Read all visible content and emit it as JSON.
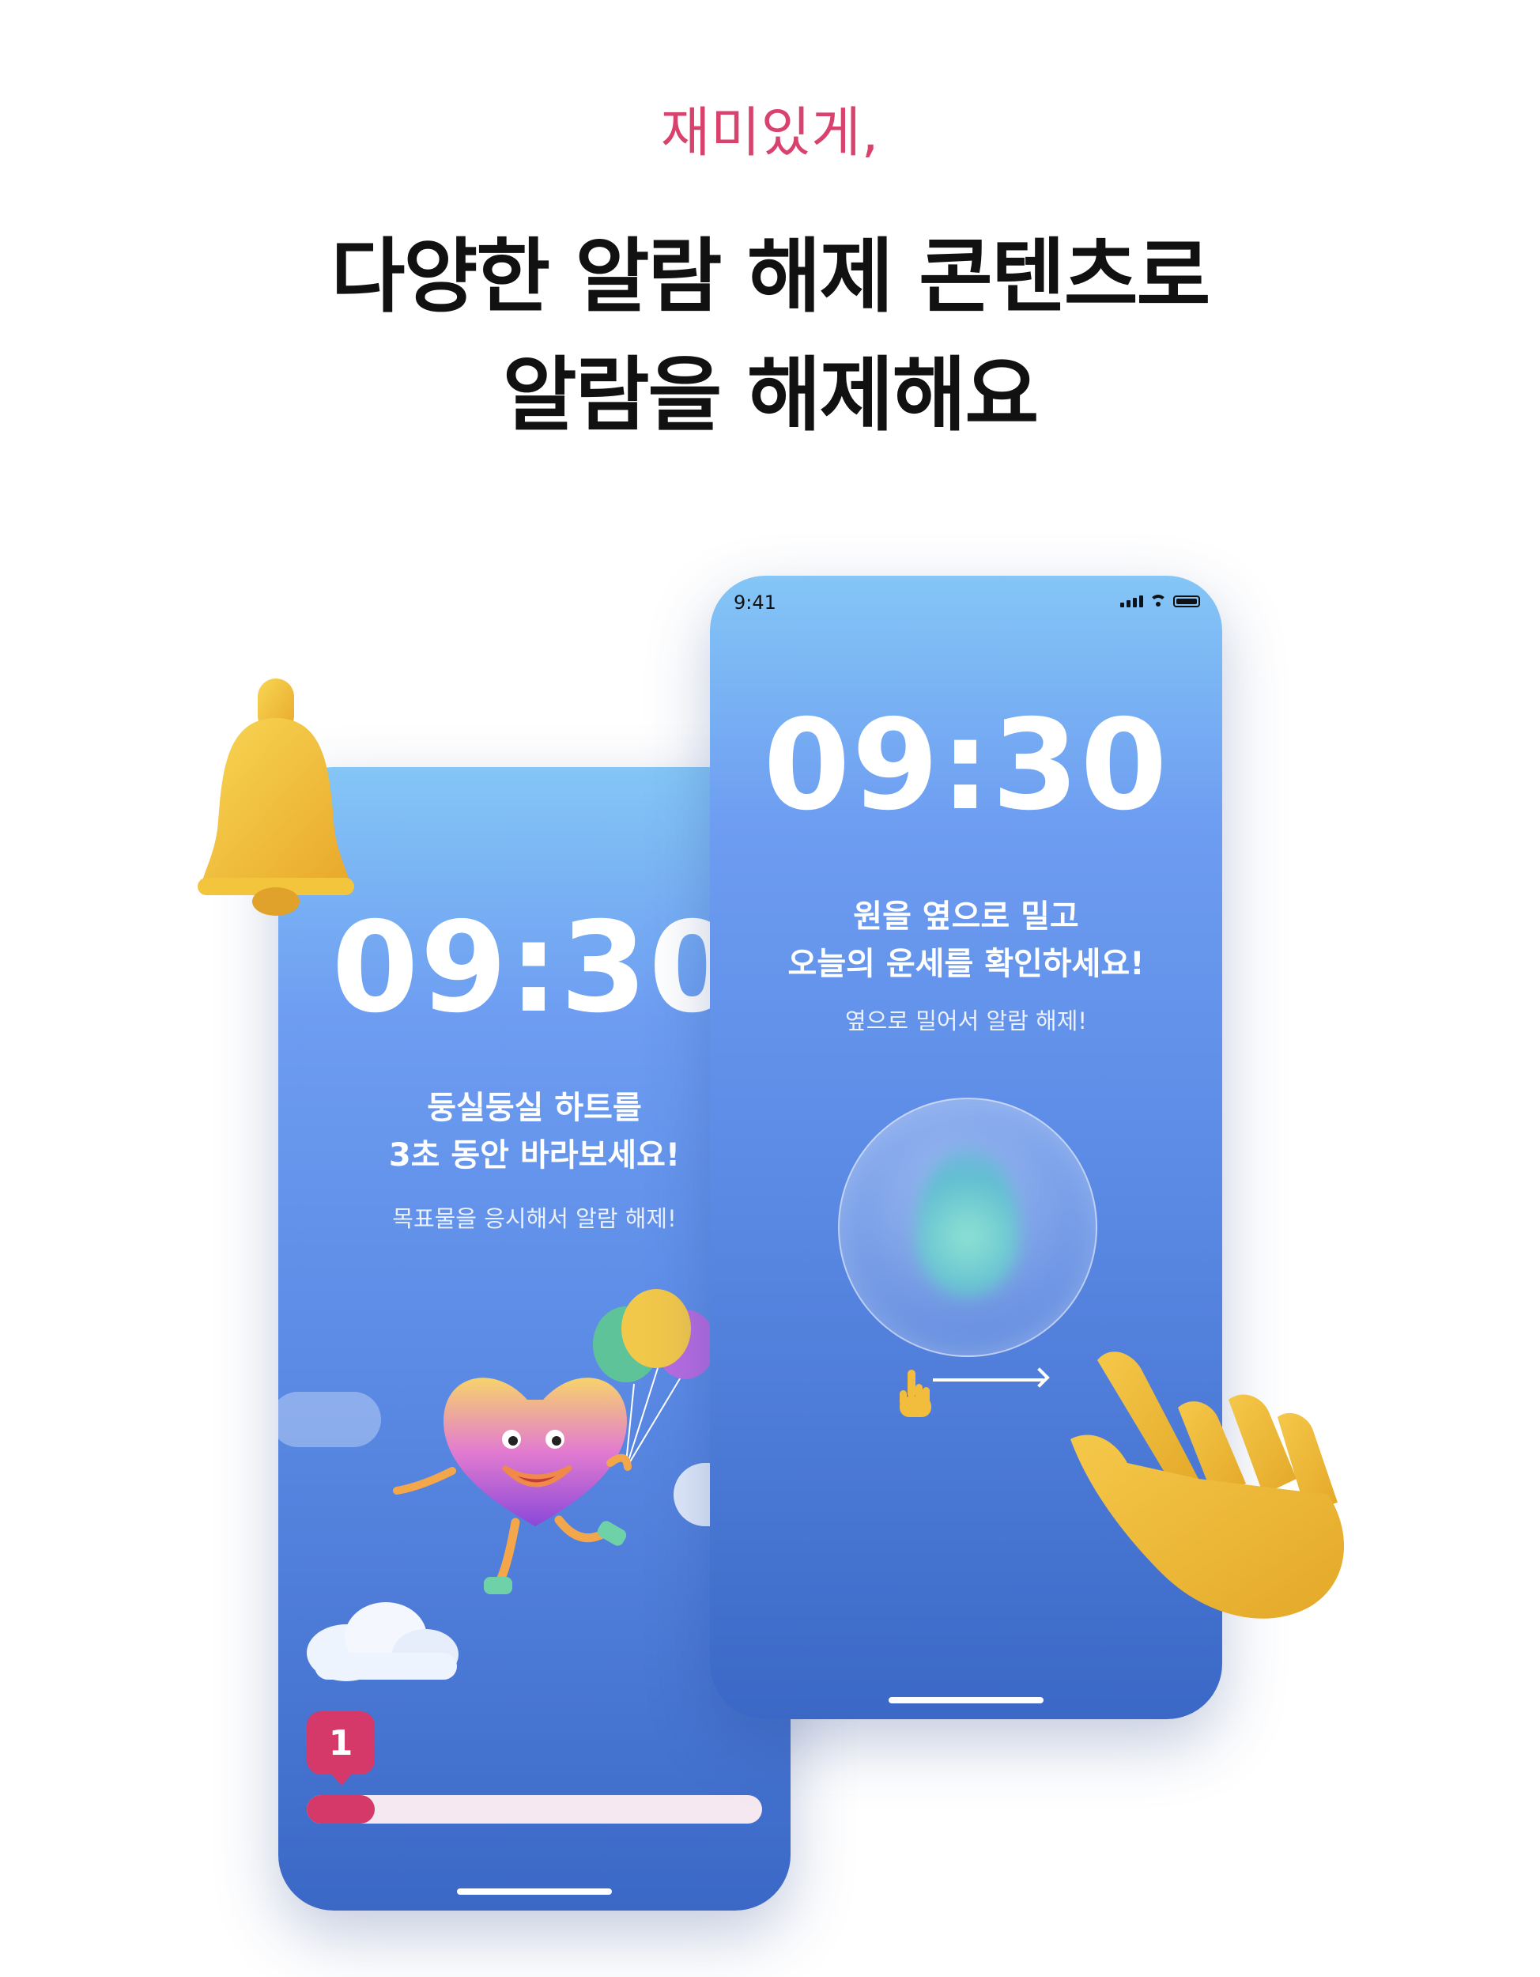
{
  "header": {
    "eyebrow": "재미있게,",
    "headline_line1": "다양한 알람 해제 콘텐츠로",
    "headline_line2": "알람을 해제해요"
  },
  "phone_left": {
    "clock": "09:30",
    "instruction_line1": "둥실둥실 하트를",
    "instruction_line2": "3초 동안 바라보세요!",
    "subtext": "목표물을 응시해서 알람 해제!",
    "count_badge": "1",
    "progress_fraction": 0.15
  },
  "phone_right": {
    "status_time": "9:41",
    "clock": "09:30",
    "instruction_line1": "원을 옆으로 밀고",
    "instruction_line2": "오늘의 운세를 확인하세요!",
    "subtext": "옆으로 밀어서 알람 해제!"
  },
  "colors": {
    "accent_pink": "#d5396a",
    "eyebrow_pink": "#d8436e",
    "phone_blue_top": "#84c6f6",
    "phone_blue_bottom": "#3b68c6",
    "bell_yellow": "#f2c331",
    "hand_yellow": "#eeb63a"
  },
  "icons": [
    "bell-icon",
    "hand-pointer-icon",
    "small-hand-icon",
    "balloons-icon",
    "heart-character-icon",
    "cloud-icon",
    "signal-icon",
    "wifi-icon",
    "battery-icon",
    "arrow-right-icon"
  ]
}
